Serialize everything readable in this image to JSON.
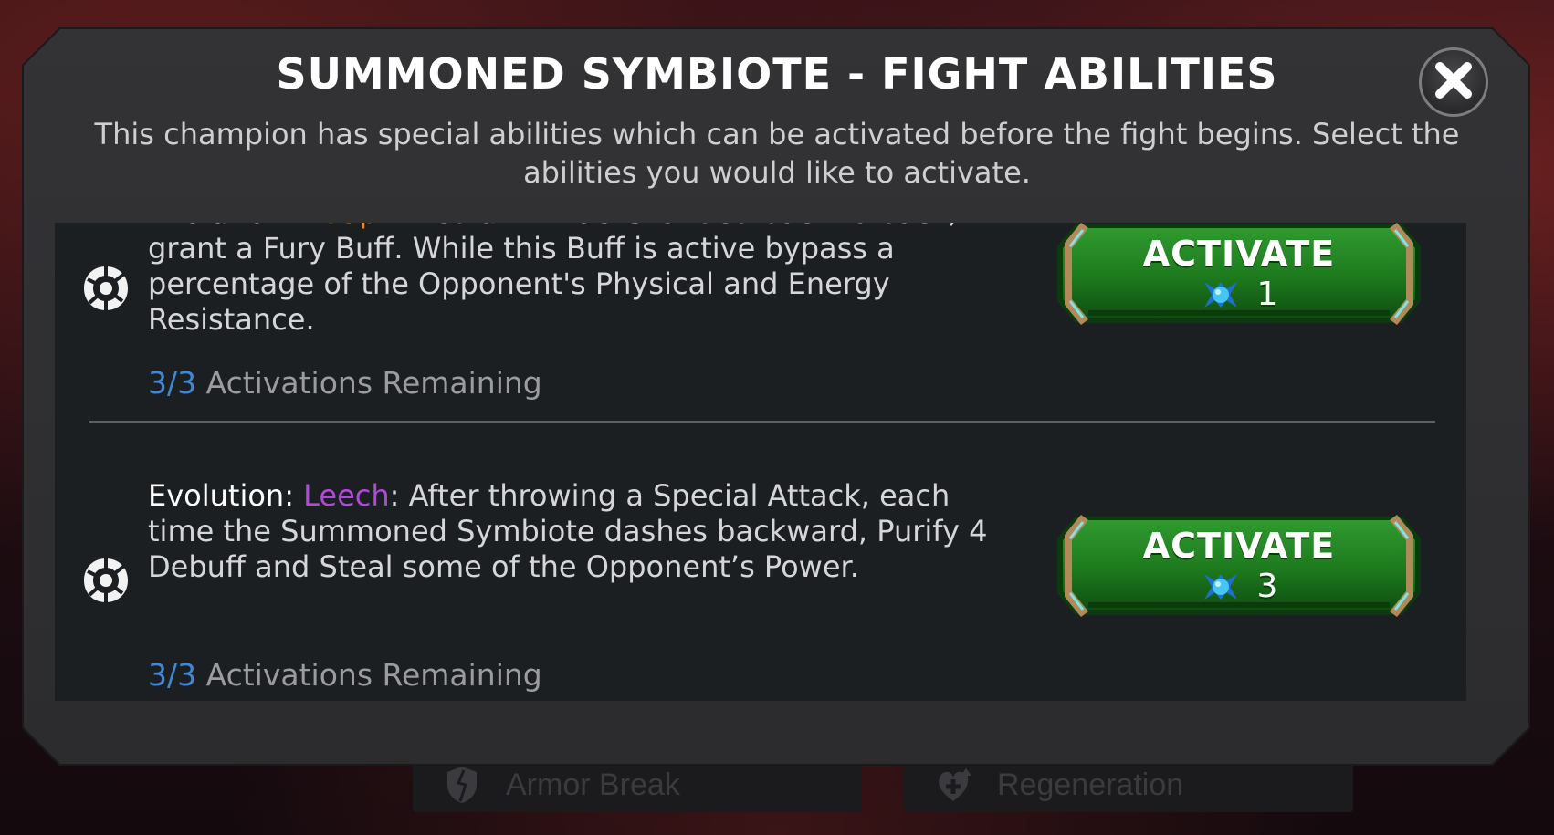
{
  "background": {
    "tabs": [
      {
        "label": "Armor Break",
        "icon": "armor-break-icon"
      },
      {
        "label": "Regeneration",
        "icon": "regeneration-icon"
      }
    ]
  },
  "dialog": {
    "title": "SUMMONED SYMBIOTE - FIGHT ABILITIES",
    "subtitle": "This champion has special abilities which can be activated before the fight begins. Select the abilities you would like to activate.",
    "close_icon": "close-icon"
  },
  "abilities": [
    {
      "label": "Evolution: ",
      "keyword": "Adapt",
      "keyword_color": "#e8892a",
      "text": ": Medium Attacks landed back to back, grant a Fury Buff. While this Buff is active bypass a percentage of the Opponent's Physical and Energy Resistance.",
      "count": "3/3",
      "remaining_label": "Activations Remaining",
      "button_label": "ACTIVATE",
      "cost": "1",
      "icon": "symbiote-icon",
      "cost_icon": "unit-crystal-icon"
    },
    {
      "label": "Evolution: ",
      "keyword": "Leech",
      "keyword_color": "#b04ad8",
      "text": ": After throwing a Special Attack, each time the Summoned Symbiote dashes backward, Purify 4 Debuff and Steal some of the Opponent’s Power.",
      "count": "3/3",
      "remaining_label": "Activations Remaining",
      "button_label": "ACTIVATE",
      "cost": "3",
      "icon": "symbiote-icon",
      "cost_icon": "unit-crystal-icon"
    }
  ],
  "colors": {
    "accent_count": "#3f88d6",
    "button_green": "#1f7a1f",
    "button_frame": "#b08a58"
  }
}
